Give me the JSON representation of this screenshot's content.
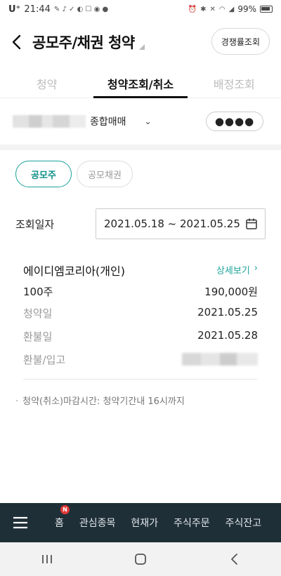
{
  "status_bar": {
    "carrier": "U⁺",
    "time": "21:44",
    "battery_percent": "99%"
  },
  "header": {
    "title": "공모주/채권 청약",
    "competition_button": "경쟁률조회"
  },
  "tabs": [
    {
      "label": "청약",
      "active": false
    },
    {
      "label": "청약조회/취소",
      "active": true
    },
    {
      "label": "배정조회",
      "active": false
    }
  ],
  "account": {
    "type_label": "종합매매",
    "password_mask": "●●●●"
  },
  "filter": {
    "ipo_label": "공모주",
    "bond_label": "공모채권",
    "selected": "공모주"
  },
  "date_query": {
    "label": "조회일자",
    "range": "2021.05.18 ~ 2021.05.25"
  },
  "subscription": {
    "name": "에이디엠코리아(개인)",
    "detail_link": "상세보기",
    "quantity": "100주",
    "amount": "190,000원",
    "subscription_date_label": "청약일",
    "subscription_date": "2021.05.25",
    "refund_date_label": "환불일",
    "refund_date": "2021.05.28",
    "refund_deposit_label": "환불/입고"
  },
  "notice": "청약(취소)마감시간: 청약기간내 16시까지",
  "bottom_nav": {
    "items": [
      "홈",
      "관심종목",
      "현재가",
      "주식주문",
      "주식잔고"
    ],
    "badge": "N"
  },
  "colors": {
    "accent": "#1aa39a",
    "nav_background": "#1f2f38"
  }
}
